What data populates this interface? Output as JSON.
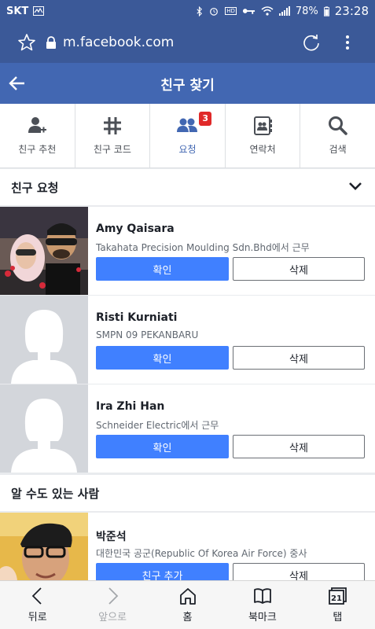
{
  "status_bar": {
    "carrier": "SKT",
    "battery": "78%",
    "time": "23:28",
    "hd_voice": "HD Voice"
  },
  "browser": {
    "url": "m.facebook.com"
  },
  "header": {
    "title": "친구 찾기"
  },
  "tabs": [
    {
      "label": "친구 추천",
      "icon": "add-friend-icon"
    },
    {
      "label": "친구 코드",
      "icon": "hash-icon"
    },
    {
      "label": "요청",
      "icon": "friends-icon",
      "badge": "3",
      "active": true
    },
    {
      "label": "연락처",
      "icon": "contacts-icon"
    },
    {
      "label": "검색",
      "icon": "search-icon"
    }
  ],
  "requests_section": {
    "title": "친구 요청"
  },
  "requests": [
    {
      "name": "Amy Qaisara",
      "subtitle": "Takahata Precision Moulding Sdn.Bhd에서 근무",
      "confirm": "확인",
      "delete": "삭제"
    },
    {
      "name": "Risti Kurniati",
      "subtitle": "SMPN 09 PEKANBARU",
      "confirm": "확인",
      "delete": "삭제"
    },
    {
      "name": "Ira Zhi Han",
      "subtitle": "Schneider Electric에서 근무",
      "confirm": "확인",
      "delete": "삭제"
    }
  ],
  "suggestions_section": {
    "title": "알 수도 있는 사람"
  },
  "suggestions": [
    {
      "name": "박준석",
      "subtitle": "대한민국 공군(Republic Of Korea Air Force) 중사",
      "add": "친구 추가",
      "delete": "삭제"
    }
  ],
  "bottom_nav": [
    {
      "label": "뒤로",
      "icon": "back-icon"
    },
    {
      "label": "앞으로",
      "icon": "forward-icon",
      "disabled": true
    },
    {
      "label": "홈",
      "icon": "home-icon"
    },
    {
      "label": "북마크",
      "icon": "bookmark-icon"
    },
    {
      "label": "탭",
      "icon": "tabs-icon",
      "count": "21"
    }
  ],
  "colors": {
    "brand": "#3b5998",
    "header": "#4267b2",
    "confirm_button": "#4080ff",
    "badge": "#e02929"
  }
}
